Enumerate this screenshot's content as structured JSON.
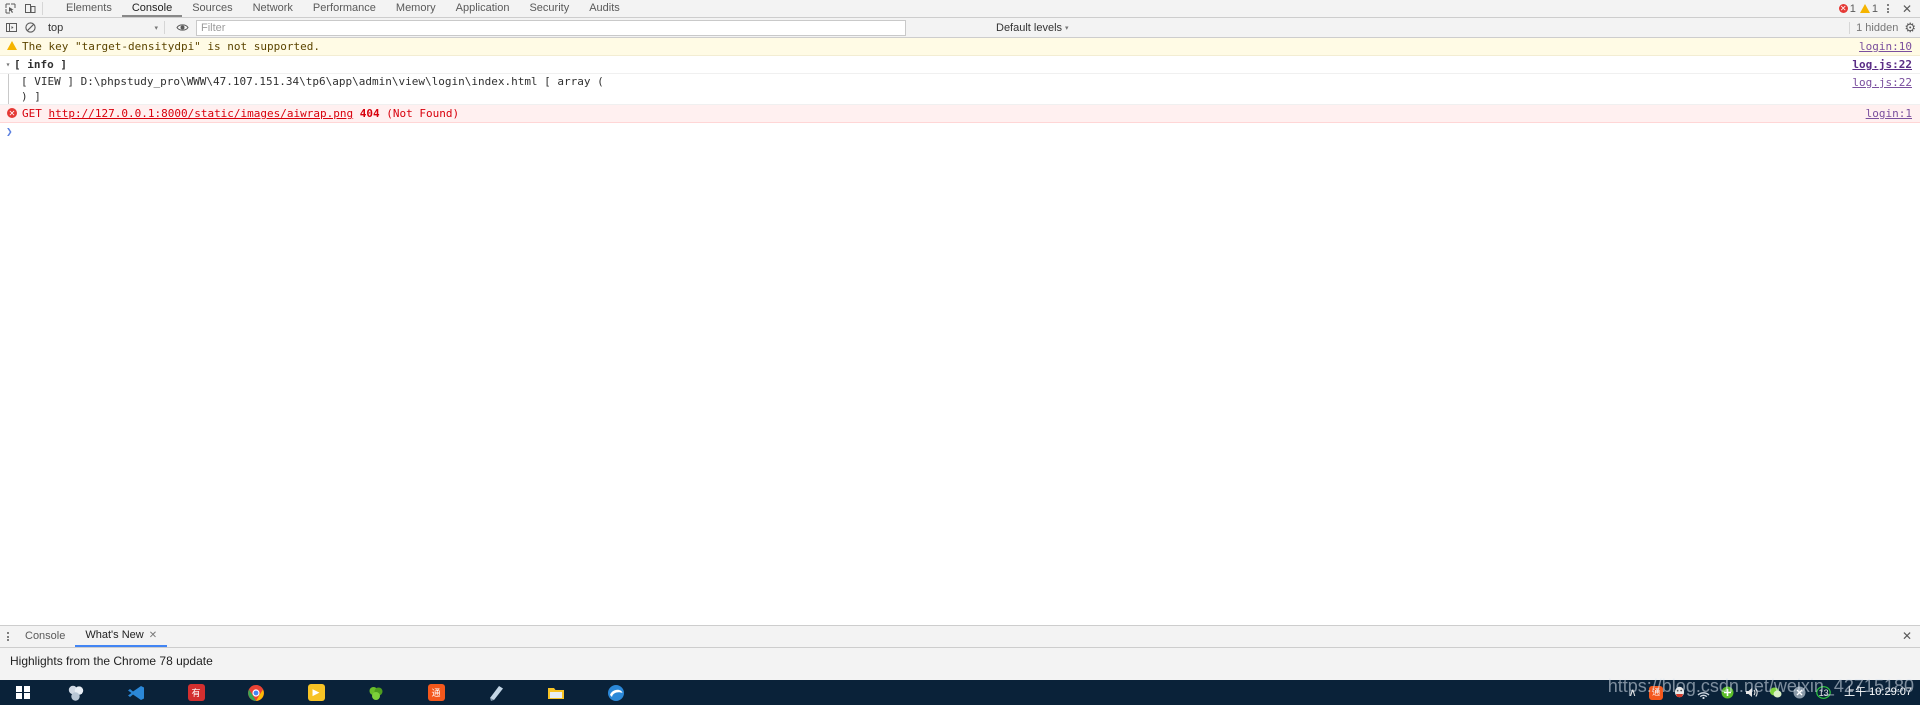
{
  "devtools": {
    "left_icons": [
      {
        "name": "inspect-element-icon",
        "glyph": "↖"
      },
      {
        "name": "device-toolbar-icon",
        "glyph": "▭"
      }
    ],
    "main_tabs": [
      {
        "label": "Elements",
        "active": false
      },
      {
        "label": "Console",
        "active": true
      },
      {
        "label": "Sources",
        "active": false
      },
      {
        "label": "Network",
        "active": false
      },
      {
        "label": "Performance",
        "active": false
      },
      {
        "label": "Memory",
        "active": false
      },
      {
        "label": "Application",
        "active": false
      },
      {
        "label": "Security",
        "active": false
      },
      {
        "label": "Audits",
        "active": false
      }
    ],
    "status": {
      "error_count": "1",
      "warning_count": "1",
      "error_glyph": "✕",
      "more_options_label": "more-options",
      "close_glyph": "✕"
    },
    "filterbar": {
      "sidebar_toggle_icon": "console-sidebar-icon",
      "clear_icon": "clear-console-icon",
      "context": "top",
      "context_caret": "▾",
      "eye_icon": "live-expression-icon",
      "filter_value": "",
      "filter_placeholder": "Filter",
      "levels_label": "Default levels",
      "levels_caret": "▾",
      "hidden_text": "1 hidden",
      "settings_icon": "gear-icon",
      "settings_glyph": "⚙"
    },
    "messages": [
      {
        "kind": "warning",
        "icon_glyph": "",
        "text": "The key \"target-densitydpi\" is not supported.",
        "source": "login:10",
        "source_bold": false
      },
      {
        "kind": "group-info",
        "arrow": "▾",
        "title": "[ info ]",
        "body": [
          "[ VIEW ] D:\\phpstudy_pro\\WWW\\47.107.151.34\\tp6\\app\\admin\\view\\login\\index.html [ array (",
          ") ]"
        ],
        "source": "log.js:22",
        "source_bold": true,
        "source_body": "log.js:22"
      },
      {
        "kind": "error",
        "icon_glyph": "✕",
        "method": "GET",
        "url": "http://127.0.0.1:8000/static/images/aiwrap.png",
        "status": "404",
        "status_text": "(Not Found)",
        "source": "login:1",
        "source_bold": false
      }
    ],
    "prompt_caret": "❯"
  },
  "drawer": {
    "tabs": [
      {
        "label": "Console",
        "active": false,
        "closeable": false
      },
      {
        "label": "What's New",
        "active": true,
        "closeable": true,
        "close_glyph": "✕"
      }
    ],
    "close_glyph": "✕",
    "content_title": "Highlights from the Chrome 78 update"
  },
  "taskbar": {
    "start_label": "windows-start",
    "apps": [
      {
        "name": "taskbar-app-photoshop",
        "label": "",
        "bg": "#0a2239",
        "fg": "#cfd8e3"
      },
      {
        "name": "taskbar-app-vscode",
        "label": "",
        "bg": "#0a2239",
        "fg": "#2b88d8"
      },
      {
        "name": "taskbar-app-youdao",
        "label": "有",
        "bg": "#d32f2f",
        "fg": "#ffffff"
      },
      {
        "name": "taskbar-app-chrome",
        "label": "",
        "bg": "#ffffff",
        "fg": "#4285f4"
      },
      {
        "name": "taskbar-app-potplayer",
        "label": "▶",
        "bg": "#f7c325",
        "fg": "#ffffff"
      },
      {
        "name": "taskbar-app-navicat",
        "label": "",
        "bg": "#0a2239",
        "fg": "#5bbd2a"
      },
      {
        "name": "taskbar-app-tongyong",
        "label": "通",
        "bg": "#f4581c",
        "fg": "#ffffff"
      },
      {
        "name": "taskbar-app-editor",
        "label": "",
        "bg": "#bfd4e6",
        "fg": "#4a6a86"
      },
      {
        "name": "taskbar-app-explorer",
        "label": "",
        "bg": "#f7c325",
        "fg": "#ffffff"
      },
      {
        "name": "taskbar-app-edge",
        "label": "",
        "bg": "#2b88d8",
        "fg": "#ffffff"
      }
    ],
    "tray": [
      {
        "name": "tray-show-hidden-icon",
        "glyph": "∧"
      },
      {
        "name": "tray-tongyong-icon",
        "glyph": "通"
      },
      {
        "name": "tray-qq-icon",
        "glyph": "•"
      },
      {
        "name": "tray-network-icon",
        "glyph": "◠"
      },
      {
        "name": "tray-shield-icon",
        "glyph": "✚"
      },
      {
        "name": "tray-volume-icon",
        "glyph": "◂"
      },
      {
        "name": "tray-wechat-icon",
        "glyph": "●"
      },
      {
        "name": "tray-close-icon",
        "glyph": "✕"
      },
      {
        "name": "tray-counter-icon",
        "glyph": "13"
      }
    ],
    "clock_period": "上午",
    "clock_time": "10:29:07"
  },
  "watermark": "https://blog.csdn.net/weixin_42715180",
  "colors": {
    "accent_blue": "#4285f4",
    "error_red": "#e53935",
    "warning_yellow": "#f5b400",
    "warn_bg": "#fffbe5",
    "error_bg": "#fff0f0",
    "link_purple": "#7a4f9e",
    "taskbar_bg": "#0a2239"
  }
}
